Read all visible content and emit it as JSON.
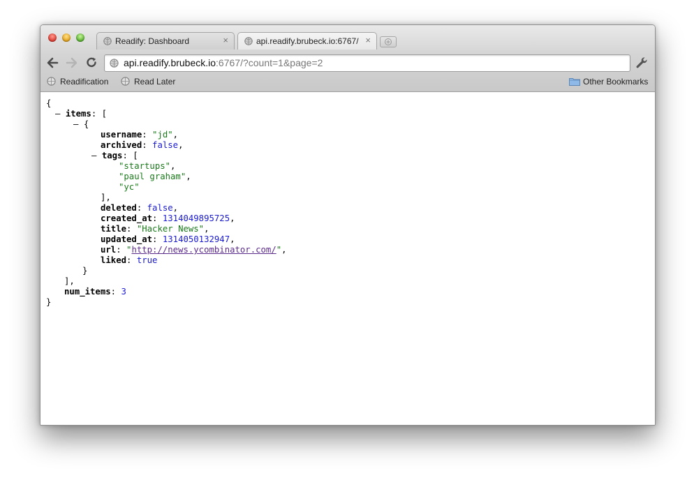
{
  "tabs": [
    {
      "label": "Readify: Dashboard",
      "active": false
    },
    {
      "label": "api.readify.brubeck.io:6767/",
      "active": true
    }
  ],
  "address": {
    "host": "api.readify.brubeck.io",
    "rest": ":6767/?count=1&page=2"
  },
  "bookmarks": [
    {
      "label": "Readification"
    },
    {
      "label": "Read Later"
    }
  ],
  "other_bookmarks": "Other Bookmarks",
  "json": {
    "open_brace": "{",
    "close_brace": "}",
    "items_key": "items",
    "items_open": "[",
    "items_close": "],",
    "obj_open": "{",
    "obj_close": "}",
    "collapse_symbol": "–",
    "colon": ": ",
    "comma": ",",
    "username_key": "username",
    "username_val": "\"jd\"",
    "archived_key": "archived",
    "archived_val": "false",
    "tags_key": "tags",
    "tags_open": "[",
    "tags": [
      "\"startups\"",
      "\"paul graham\"",
      "\"yc\""
    ],
    "tags_close": "],",
    "deleted_key": "deleted",
    "deleted_val": "false",
    "created_at_key": "created_at",
    "created_at_val": "1314049895725",
    "title_key": "title",
    "title_val": "\"Hacker News\"",
    "updated_at_key": "updated_at",
    "updated_at_val": "1314050132947",
    "url_key": "url",
    "url_quote": "\"",
    "url_val": "http://news.ycombinator.com/",
    "liked_key": "liked",
    "liked_val": "true",
    "num_items_key": "num_items",
    "num_items_val": "3"
  },
  "icons": {
    "tab": "globe-icon",
    "close": "close-icon",
    "back": "back-arrow-icon",
    "forward": "forward-arrow-icon",
    "reload": "reload-icon",
    "menu": "wrench-icon",
    "folder": "folder-icon"
  },
  "colors": {
    "string": "#1a7a1a",
    "number": "#1a1ad0",
    "link": "#5a2a8a"
  }
}
